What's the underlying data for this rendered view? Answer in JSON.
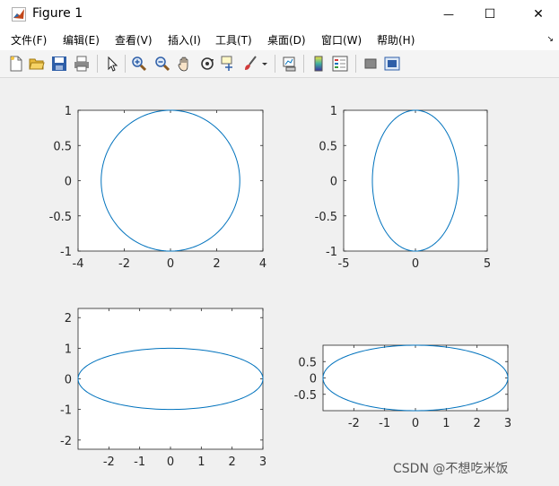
{
  "window": {
    "title": "Figure 1",
    "minimize_glyph": "—",
    "maximize_glyph": "☐",
    "close_glyph": "✕"
  },
  "menu": {
    "items": [
      "文件(F)",
      "编辑(E)",
      "查看(V)",
      "插入(I)",
      "工具(T)",
      "桌面(D)",
      "窗口(W)",
      "帮助(H)"
    ],
    "dock_glyph": "↘"
  },
  "toolbar": {
    "icons": [
      "new-figure-icon",
      "open-file-icon",
      "save-icon",
      "print-icon",
      "edit-plot-arrow-icon",
      "zoom-in-icon",
      "zoom-out-icon",
      "pan-hand-icon",
      "rotate-3d-icon",
      "data-cursor-icon",
      "brush-icon",
      "brush-dropdown-icon",
      "link-plot-icon",
      "colorbar-icon",
      "legend-icon",
      "hide-plot-tools-icon",
      "show-plot-tools-icon"
    ]
  },
  "colors": {
    "line": "#0072bd",
    "axes_bg": "#ffffff",
    "figure_bg": "#f0f0f0",
    "text": "#262626"
  },
  "chart_data": [
    {
      "type": "line",
      "title": "",
      "xlabel": "",
      "ylabel": "",
      "series": [
        {
          "shape": "ellipse",
          "a": 3,
          "b": 1,
          "x_range": [
            -3,
            3
          ],
          "y_range": [
            -1,
            1
          ]
        }
      ],
      "xlim": [
        -4,
        4
      ],
      "ylim": [
        -1,
        1
      ],
      "xticks": [
        -4,
        -2,
        0,
        2,
        4
      ],
      "xticklabels": [
        "-4",
        "-2",
        "0",
        "2",
        "4"
      ],
      "yticks": [
        -1,
        -0.5,
        0,
        0.5,
        1
      ],
      "yticklabels": [
        "-1",
        "-0.5",
        "0",
        "0.5",
        "1"
      ],
      "grid": false
    },
    {
      "type": "line",
      "title": "",
      "xlabel": "",
      "ylabel": "",
      "series": [
        {
          "shape": "ellipse",
          "a": 3,
          "b": 1,
          "x_range": [
            -3,
            3
          ],
          "y_range": [
            -1,
            1
          ]
        }
      ],
      "xlim": [
        -5,
        5
      ],
      "ylim": [
        -1,
        1
      ],
      "xticks": [
        -5,
        0,
        5
      ],
      "xticklabels": [
        "-5",
        "0",
        "5"
      ],
      "yticks": [
        -1,
        -0.5,
        0,
        0.5,
        1
      ],
      "yticklabels": [
        "-1",
        "-0.5",
        "0",
        "0.5",
        "1"
      ],
      "grid": false
    },
    {
      "type": "line",
      "title": "",
      "xlabel": "",
      "ylabel": "",
      "series": [
        {
          "shape": "ellipse",
          "a": 3,
          "b": 1,
          "x_range": [
            -3,
            3
          ],
          "y_range": [
            -1,
            1
          ]
        }
      ],
      "xlim": [
        -3,
        3
      ],
      "ylim": [
        -2.3,
        2.3
      ],
      "xticks": [
        -2,
        -1,
        0,
        1,
        2,
        3
      ],
      "xticklabels": [
        "-2",
        "-1",
        "0",
        "1",
        "2",
        "3"
      ],
      "yticks": [
        -2,
        -1,
        0,
        1,
        2
      ],
      "yticklabels": [
        "-2",
        "-1",
        "0",
        "1",
        "2"
      ],
      "grid": false
    },
    {
      "type": "line",
      "title": "",
      "xlabel": "",
      "ylabel": "",
      "series": [
        {
          "shape": "ellipse",
          "a": 3,
          "b": 1,
          "x_range": [
            -3,
            3
          ],
          "y_range": [
            -1,
            1
          ]
        }
      ],
      "xlim": [
        -3,
        3
      ],
      "ylim": [
        -1,
        1
      ],
      "xticks": [
        -2,
        -1,
        0,
        1,
        2,
        3
      ],
      "xticklabels": [
        "-2",
        "-1",
        "0",
        "1",
        "2",
        "3"
      ],
      "yticks": [
        -0.5,
        0,
        0.5
      ],
      "yticklabels": [
        "-0.5",
        "0",
        "0.5"
      ],
      "grid": false
    }
  ],
  "watermark": "CSDN @不想吃米饭"
}
